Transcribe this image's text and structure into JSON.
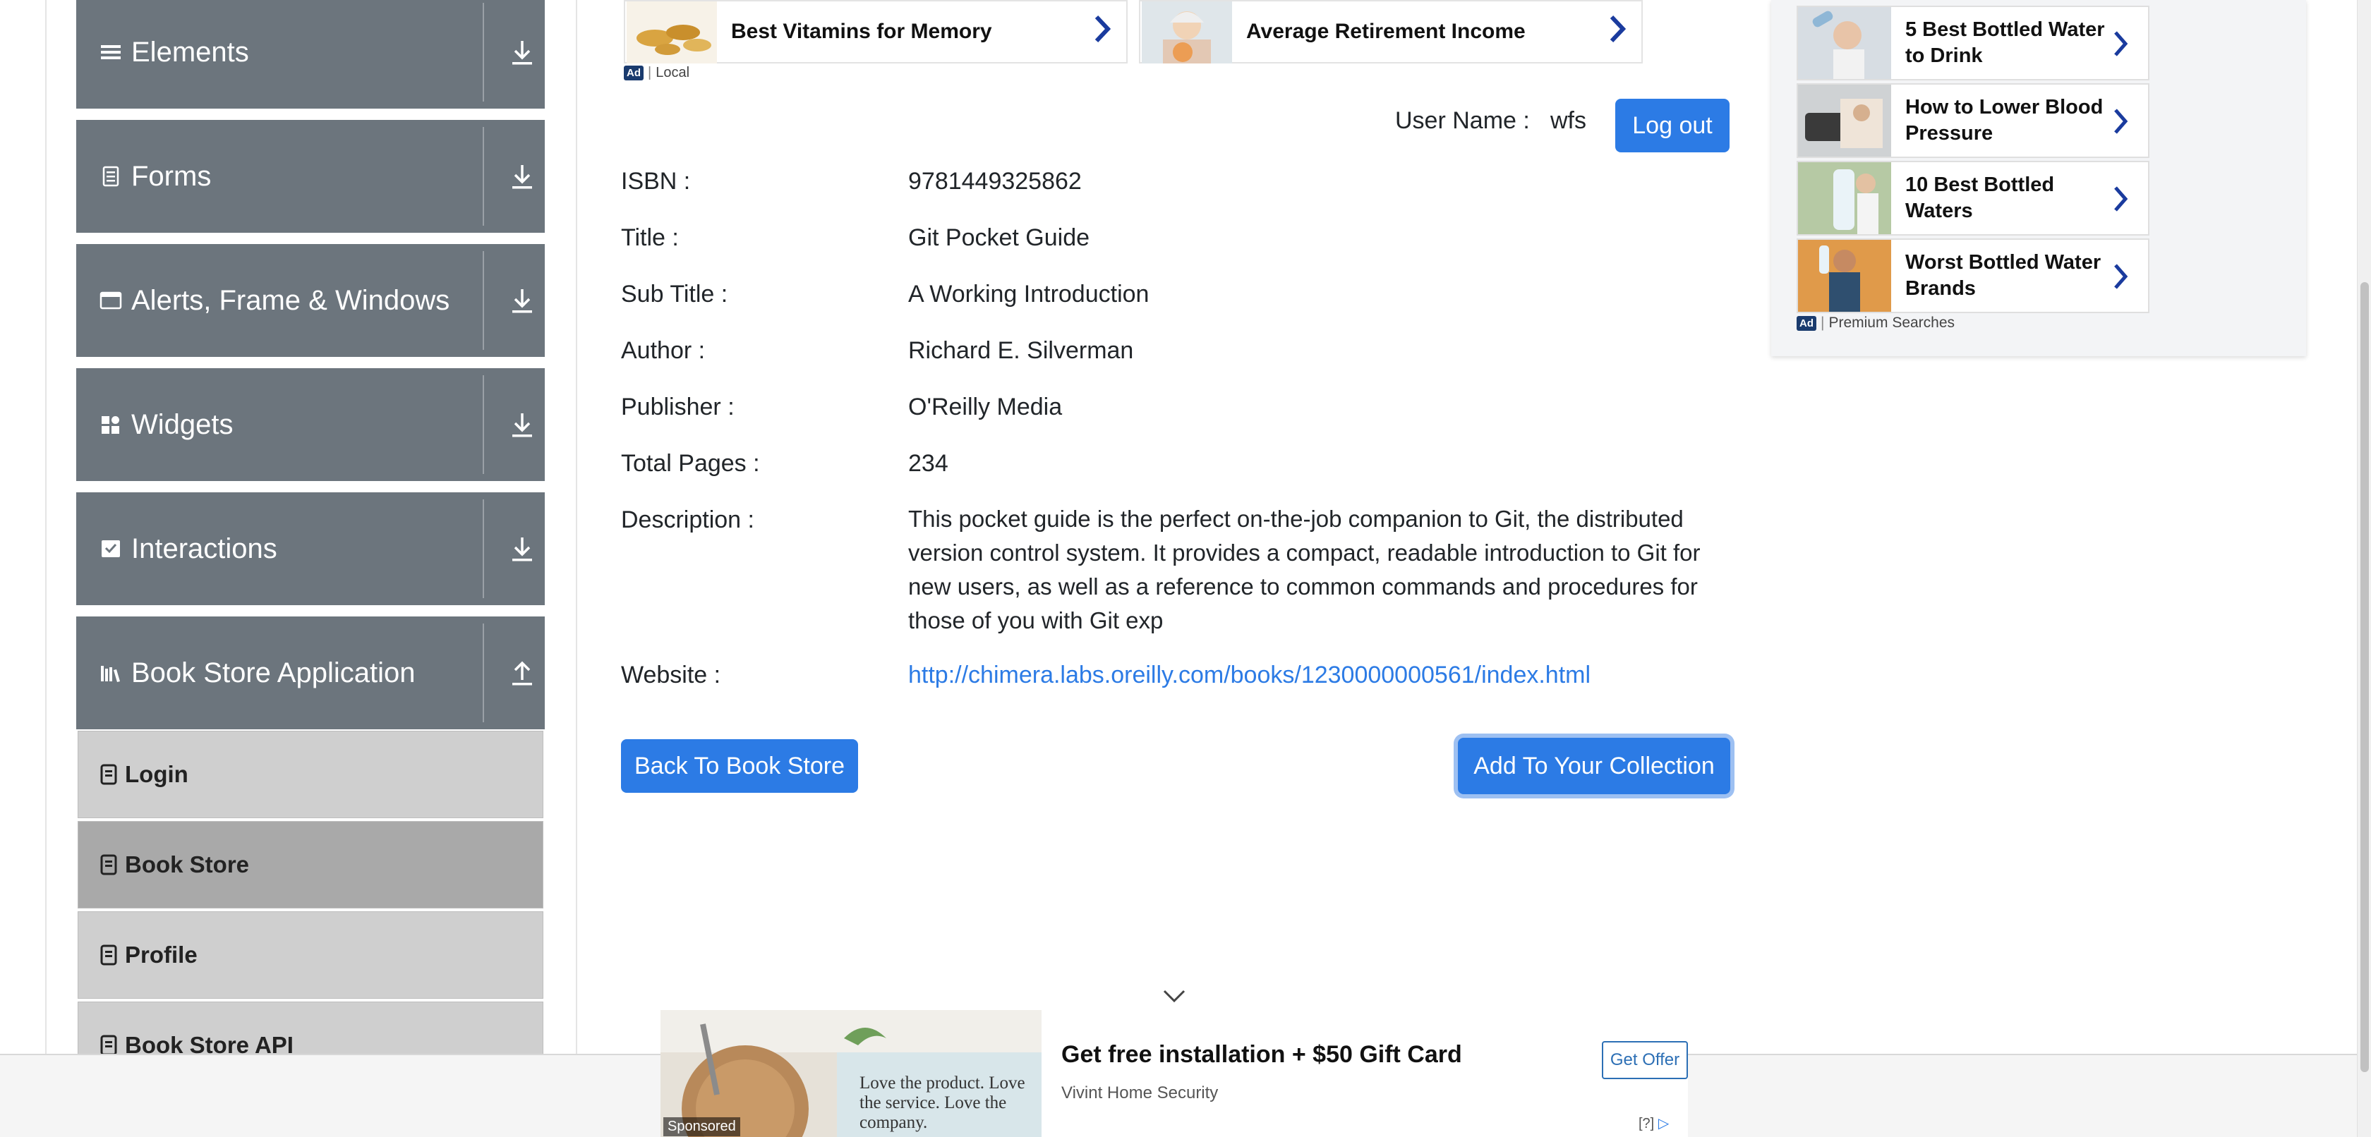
{
  "sidebar": {
    "groups": [
      {
        "title": "Elements",
        "icon": "hamburger-icon",
        "state": "collapsed"
      },
      {
        "title": "Forms",
        "icon": "form-icon",
        "state": "collapsed"
      },
      {
        "title": "Alerts, Frame & Windows",
        "icon": "window-icon",
        "state": "collapsed"
      },
      {
        "title": "Widgets",
        "icon": "widgets-icon",
        "state": "collapsed"
      },
      {
        "title": "Interactions",
        "icon": "interactions-icon",
        "state": "collapsed"
      },
      {
        "title": "Book Store Application",
        "icon": "books-icon",
        "state": "expanded"
      }
    ],
    "book_store_items": [
      {
        "label": "Login",
        "active": false
      },
      {
        "label": "Book Store",
        "active": true
      },
      {
        "label": "Profile",
        "active": false
      },
      {
        "label": "Book Store API",
        "active": false
      }
    ]
  },
  "top_ads": {
    "cards": [
      {
        "text": "Best Vitamins for Memory"
      },
      {
        "text": "Average Retirement Income"
      }
    ],
    "badge": "Ad",
    "source": "Local"
  },
  "header": {
    "user_label": "User Name :",
    "user_name": "wfs",
    "logout_label": "Log out"
  },
  "book": {
    "fields": [
      {
        "label": "ISBN :",
        "value": "9781449325862"
      },
      {
        "label": "Title :",
        "value": "Git Pocket Guide"
      },
      {
        "label": "Sub Title :",
        "value": "A Working Introduction"
      },
      {
        "label": "Author :",
        "value": "Richard E. Silverman"
      },
      {
        "label": "Publisher :",
        "value": "O'Reilly Media"
      },
      {
        "label": "Total Pages :",
        "value": "234"
      }
    ],
    "description_label": "Description :",
    "description": "This pocket guide is the perfect on-the-job companion to Git, the distributed version control system. It provides a compact, readable introduction to Git for new users, as well as a reference to common commands and procedures for those of you with Git exp",
    "website_label": "Website :",
    "website": "http://chimera.labs.oreilly.com/books/1230000000561/index.html"
  },
  "actions": {
    "back_label": "Back To Book Store",
    "add_label": "Add To Your Collection"
  },
  "right_ad": {
    "cards": [
      {
        "text": "5 Best Bottled Water to Drink"
      },
      {
        "text": "How to Lower Blood Pressure"
      },
      {
        "text": "10 Best Bottled Waters"
      },
      {
        "text": "Worst Bottled Water Brands"
      }
    ],
    "badge": "Ad",
    "footer": "Premium Searches"
  },
  "bottom_ad": {
    "quote": "Love the product. Love the service. Love the company.",
    "sponsored": "Sponsored",
    "title": "Get free installation + $50 Gift Card",
    "advertiser": "Vivint Home Security",
    "cta": "Get Offer",
    "info": "[?]"
  },
  "colors": {
    "sidebar_group_bg": "#6c757d",
    "menu_item_bg": "#cfcfcf",
    "menu_item_active_bg": "#a9a9a9",
    "primary_button": "#2c7be5",
    "link": "#2c7be5"
  }
}
